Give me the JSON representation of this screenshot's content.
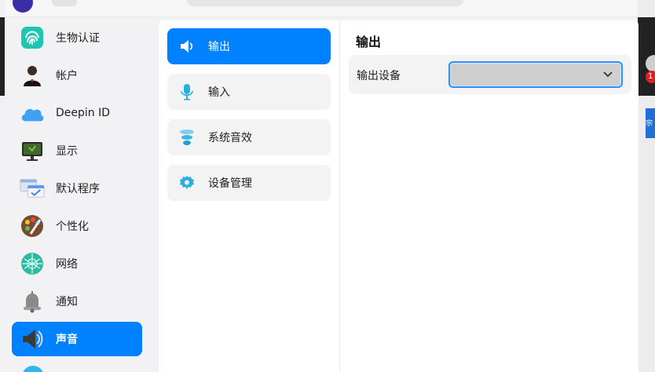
{
  "sidebar": {
    "items": [
      {
        "label": "生物认证",
        "icon": "fingerprint-icon"
      },
      {
        "label": "帐户",
        "icon": "user-account-icon"
      },
      {
        "label": "Deepin ID",
        "icon": "cloud-icon"
      },
      {
        "label": "显示",
        "icon": "monitor-icon"
      },
      {
        "label": "默认程序",
        "icon": "default-apps-icon"
      },
      {
        "label": "个性化",
        "icon": "palette-icon"
      },
      {
        "label": "网络",
        "icon": "network-icon"
      },
      {
        "label": "通知",
        "icon": "bell-icon"
      },
      {
        "label": "声音",
        "icon": "speaker-icon",
        "active": true
      }
    ]
  },
  "sound_menu": {
    "items": [
      {
        "label": "输出",
        "icon": "speaker-output-icon",
        "active": true
      },
      {
        "label": "输入",
        "icon": "microphone-icon"
      },
      {
        "label": "系统音效",
        "icon": "sound-effects-icon"
      },
      {
        "label": "设备管理",
        "icon": "gear-icon"
      }
    ]
  },
  "content": {
    "title": "输出",
    "output_device_label": "输出设备",
    "output_device_value": ""
  },
  "background": {
    "badge": "1",
    "side_text": "宗"
  },
  "colors": {
    "accent": "#0081ff",
    "focus_border": "#2f8fff"
  }
}
